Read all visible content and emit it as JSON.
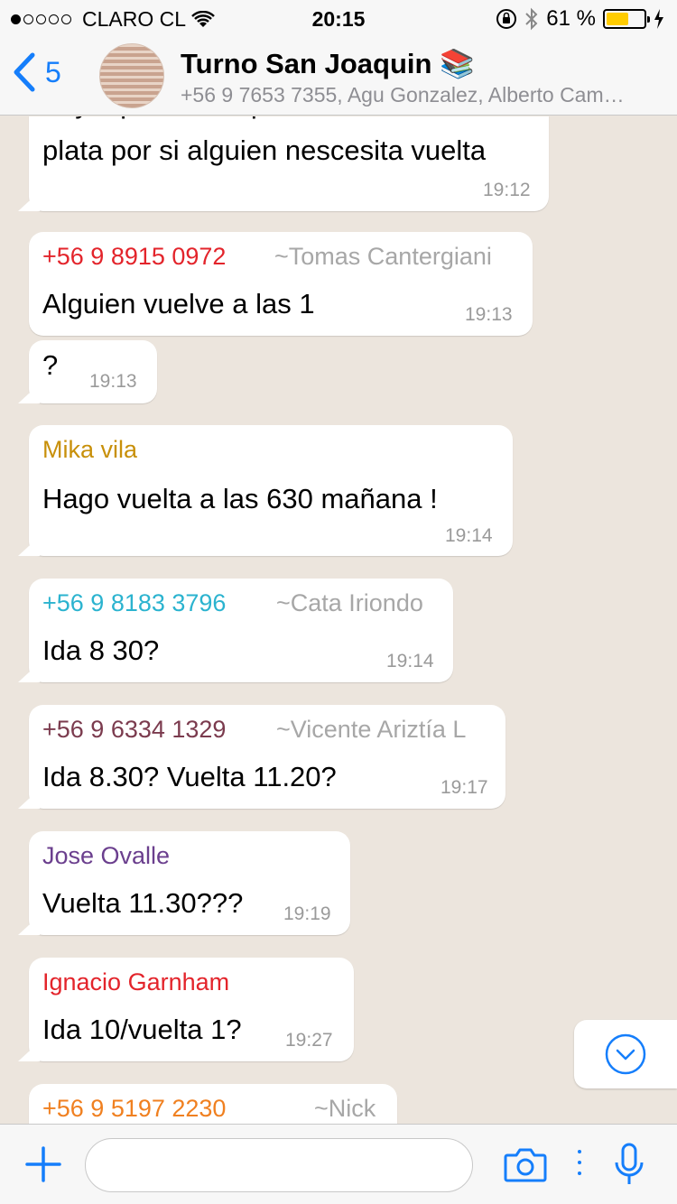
{
  "status_bar": {
    "carrier": "CLARO CL",
    "time": "20:15",
    "battery_percent": "61 %",
    "battery_level": 0.61
  },
  "header": {
    "back_count": "5",
    "title": "Turno San Joaquin 📚",
    "participants": "+56 9 7653 7355, Agu Gonzalez, Alberto Cam…"
  },
  "messages": [
    {
      "line1": "Voy a pasar a la petrobras a sacar",
      "text": "plata por si alguien nescesita vuelta",
      "time": "19:12"
    },
    {
      "sender": "+56 9 8915 0972",
      "alias": "~Tomas Cantergiani",
      "text": "Alguien vuelve a las 1",
      "time": "19:13",
      "color": "#E3242B"
    },
    {
      "text": "?",
      "time": "19:13"
    },
    {
      "sender": "Mika vila",
      "text": "Hago vuelta a las 630 mañana !",
      "time": "19:14",
      "color": "#C8900A"
    },
    {
      "sender": "+56 9 8183 3796",
      "alias": "~Cata Iriondo",
      "text": "Ida 8 30?",
      "time": "19:14",
      "color": "#2BB3CF"
    },
    {
      "sender": "+56 9 6334 1329",
      "alias": "~Vicente Ariztía L",
      "text": "Ida 8.30? Vuelta 11.20?",
      "time": "19:17",
      "color": "#7B3B4E"
    },
    {
      "sender": "Jose Ovalle",
      "text": "Vuelta 11.30???",
      "time": "19:19",
      "color": "#6B3F8E"
    },
    {
      "sender": "Ignacio Garnham",
      "text": "Ida 10/vuelta 1?",
      "time": "19:27",
      "color": "#E3242B"
    },
    {
      "sender": "+56 9 5197 2230",
      "alias": "~Nick",
      "color": "#F08020"
    }
  ],
  "icons": {
    "back": "chevron-left-icon",
    "plus": "plus-icon",
    "camera": "camera-icon",
    "mic": "microphone-icon",
    "scroll": "chevron-down-icon"
  },
  "colors": {
    "accent": "#157EFB",
    "chat_background": "#ECE5DD",
    "battery": "#FFCC00"
  }
}
